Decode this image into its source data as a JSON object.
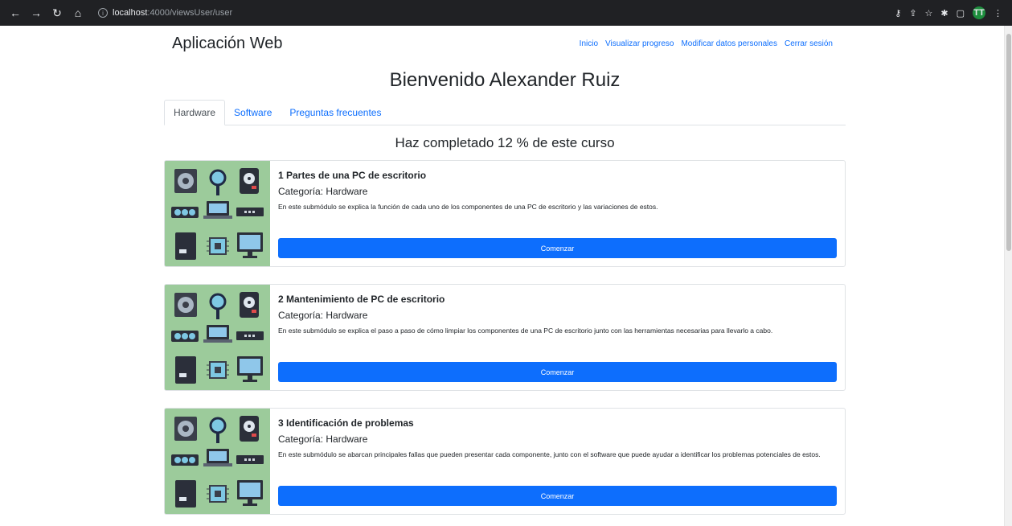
{
  "browser": {
    "url_host": "localhost",
    "url_rest": ":4000/viewsUser/user",
    "profile_initials": "TT"
  },
  "navbar": {
    "brand": "Aplicación Web",
    "links": [
      "Inicio",
      "Visualizar progreso",
      "Modificar datos personales",
      "Cerrar sesión"
    ]
  },
  "welcome": "Bienvenido Alexander Ruiz",
  "tabs": [
    {
      "label": "Hardware"
    },
    {
      "label": "Software"
    },
    {
      "label": "Preguntas frecuentes"
    }
  ],
  "progress": {
    "text": "Haz completado 12 % de este curso",
    "percent": 12
  },
  "modules": [
    {
      "title": "1 Partes de una PC de escritorio",
      "category": "Categoría: Hardware",
      "description": "En este submódulo se explica la función de cada uno de los componentes de una PC de escritorio y las variaciones de estos.",
      "button": "Comenzar"
    },
    {
      "title": "2 Mantenimiento de PC de escritorio",
      "category": "Categoría: Hardware",
      "description": "En este submódulo se explica el paso a paso de cómo limpiar los componentes de una PC de escritorio junto con las herramientas necesarias para llevarlo a cabo.",
      "button": "Comenzar"
    },
    {
      "title": "3 Identificación de problemas",
      "category": "Categoría: Hardware",
      "description": "En este submódulo se abarcan principales fallas que pueden presentar cada componente, junto con el software que puede ayudar a identificar los problemas potenciales de estos.",
      "button": "Comenzar"
    }
  ],
  "colors": {
    "primary": "#0d6efd",
    "thumb_bg": "#9ccb9b"
  }
}
